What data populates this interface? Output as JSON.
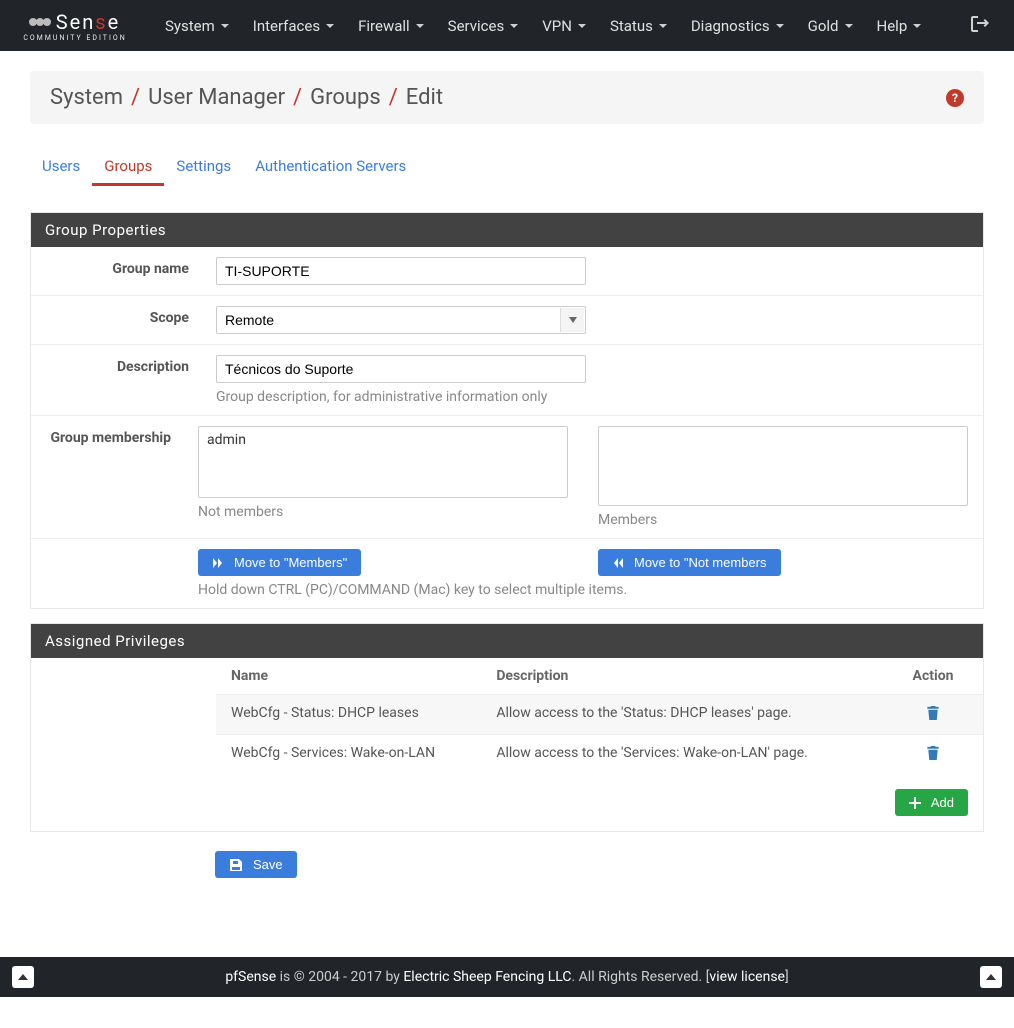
{
  "brand": {
    "main_pre": "Sen",
    "main_accent": "s",
    "main_post": "e",
    "sub": "Community Edition"
  },
  "nav": {
    "items": [
      {
        "label": "System"
      },
      {
        "label": "Interfaces"
      },
      {
        "label": "Firewall"
      },
      {
        "label": "Services"
      },
      {
        "label": "VPN"
      },
      {
        "label": "Status"
      },
      {
        "label": "Diagnostics"
      },
      {
        "label": "Gold"
      },
      {
        "label": "Help"
      }
    ]
  },
  "breadcrumb": {
    "items": [
      "System",
      "User Manager",
      "Groups",
      "Edit"
    ]
  },
  "tabs": {
    "items": [
      {
        "label": "Users",
        "active": false
      },
      {
        "label": "Groups",
        "active": true
      },
      {
        "label": "Settings",
        "active": false
      },
      {
        "label": "Authentication Servers",
        "active": false
      }
    ]
  },
  "panels": {
    "properties_title": "Group Properties",
    "privileges_title": "Assigned Privileges"
  },
  "form": {
    "group_name_label": "Group name",
    "group_name_value": "TI-SUPORTE",
    "scope_label": "Scope",
    "scope_value": "Remote",
    "description_label": "Description",
    "description_value": "Técnicos do Suporte",
    "description_help": "Group description, for administrative information only",
    "membership_label": "Group membership",
    "not_members_caption": "Not members",
    "members_caption": "Members",
    "not_members_items": [
      "admin"
    ],
    "move_to_members_label": "Move to \"Members\"",
    "move_to_notmembers_label": "Move to \"Not members",
    "move_help": "Hold down CTRL (PC)/COMMAND (Mac) key to select multiple items."
  },
  "privileges": {
    "columns": {
      "name": "Name",
      "description": "Description",
      "action": "Action"
    },
    "rows": [
      {
        "name": "WebCfg - Status: DHCP leases",
        "description": "Allow access to the 'Status: DHCP leases' page."
      },
      {
        "name": "WebCfg - Services: Wake-on-LAN",
        "description": "Allow access to the 'Services: Wake-on-LAN' page."
      }
    ],
    "add_label": "Add"
  },
  "save_label": "Save",
  "footer": {
    "brand": "pfSense",
    "copyright": " is © 2004 - 2017 by ",
    "company": "Electric Sheep Fencing LLC",
    "rights": ". All Rights Reserved. ",
    "view_license": "view license"
  }
}
